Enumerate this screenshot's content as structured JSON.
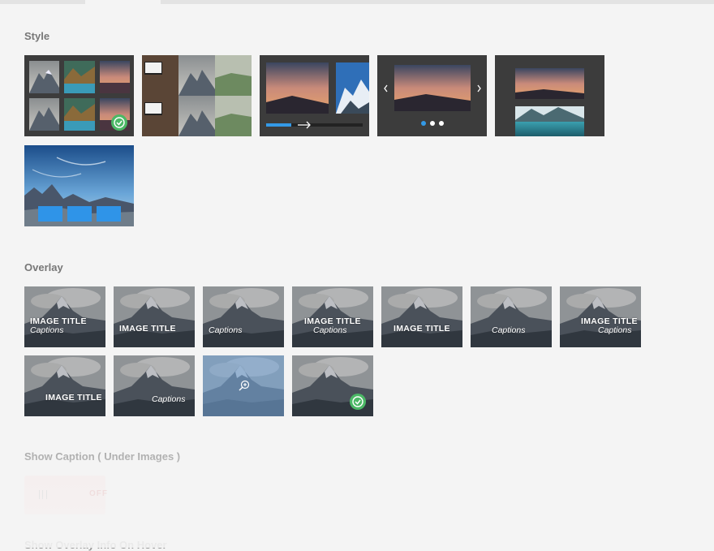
{
  "sections": {
    "style": "Style",
    "overlay": "Overlay",
    "show_caption": "Show Caption ( Under Images )",
    "show_overlay_hover": "Show Overlay Info On Hover"
  },
  "overlay": {
    "image_title": "IMAGE TITLE",
    "captions": "Captions"
  },
  "toggle": {
    "state": "OFF"
  },
  "selected": {
    "style": "grid",
    "overlay": "fade"
  },
  "colors": {
    "accent": "#3399e6",
    "check": "#4cb866",
    "dark_panel": "#3c3c3c"
  }
}
